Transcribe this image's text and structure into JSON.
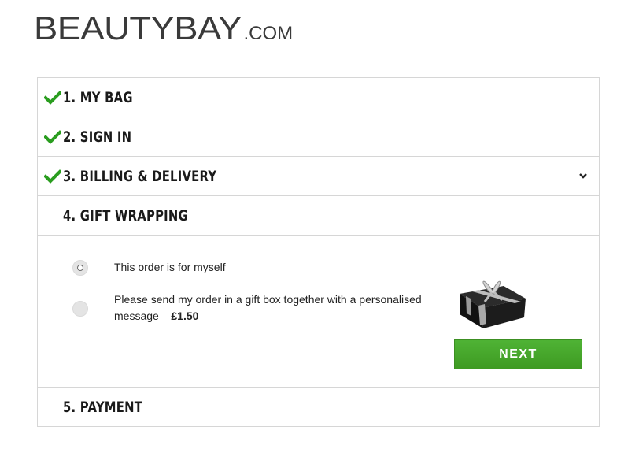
{
  "logo": {
    "main": "BEAUTYBAY",
    "sub": ".COM"
  },
  "steps": [
    {
      "title": "1. MY BAG",
      "completed": true
    },
    {
      "title": "2. SIGN IN",
      "completed": true
    },
    {
      "title": "3. BILLING & DELIVERY",
      "completed": true,
      "icon": "chevron-down-icon"
    },
    {
      "title": "4. GIFT WRAPPING",
      "completed": false
    },
    {
      "title": "5. PAYMENT",
      "completed": false
    }
  ],
  "gift_wrapping": {
    "options": [
      {
        "label": "This order is for myself",
        "selected": true
      },
      {
        "label_prefix": "Please send my order in a gift box together with a personalised message – ",
        "price": "£1.50",
        "selected": false
      }
    ],
    "next_label": "NEXT",
    "image_icon": "gift-box-icon"
  },
  "colors": {
    "check_green": "#2a9d1f",
    "button_green": "#47a92d",
    "logo_gray": "#3a3a3a",
    "border": "#d6d6d6"
  }
}
